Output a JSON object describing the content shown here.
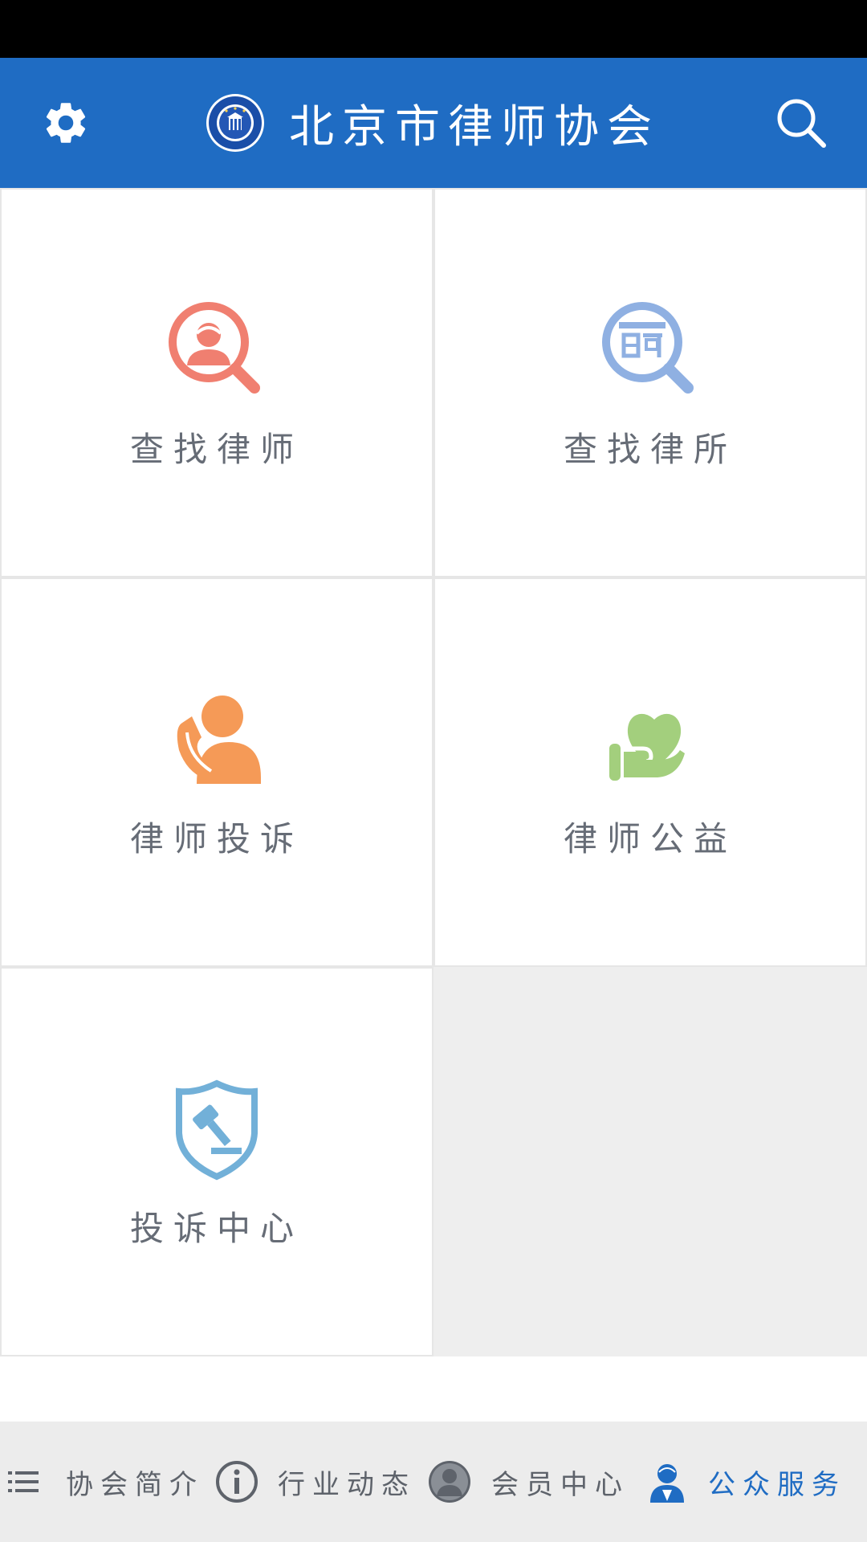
{
  "header": {
    "title": "北京市律师协会",
    "logo_text": "BEIJING LAWYERS ASSOCIATION"
  },
  "tiles": [
    {
      "label": "查找律师",
      "icon": "lawyer-search-icon",
      "color": "#f07f70"
    },
    {
      "label": "查找律所",
      "icon": "firm-search-icon",
      "color": "#8fb0e2"
    },
    {
      "label": "律师投诉",
      "icon": "phone-person-icon",
      "color": "#f59a57"
    },
    {
      "label": "律师公益",
      "icon": "heart-hand-icon",
      "color": "#a3cf7d"
    },
    {
      "label": "投诉中心",
      "icon": "gavel-shield-icon",
      "color": "#72b0d8"
    }
  ],
  "bottom_nav": {
    "items": [
      {
        "label": "协会简介",
        "icon": "list-icon"
      },
      {
        "label": "行业动态",
        "icon": "info-icon"
      },
      {
        "label": "会员中心",
        "icon": "member-icon"
      },
      {
        "label": "公众服务",
        "icon": "public-service-icon",
        "active": true
      }
    ]
  },
  "colors": {
    "primary": "#1f6cc3",
    "label_gray": "#666c76",
    "empty_cell": "#eeeeee"
  }
}
